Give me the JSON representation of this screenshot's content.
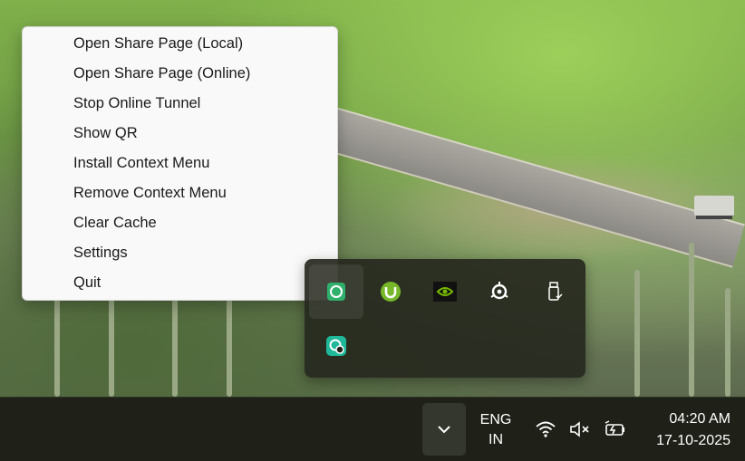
{
  "context_menu": {
    "items": [
      "Open Share Page (Local)",
      "Open Share Page (Online)",
      "Stop Online Tunnel",
      "Show QR",
      "Install Context Menu",
      "Remove Context Menu",
      "Clear Cache",
      "Settings",
      "Quit"
    ]
  },
  "tray_overflow": {
    "icons": [
      {
        "name": "share-app-icon",
        "color": "#2fb16b"
      },
      {
        "name": "utorrent-icon",
        "color": "#76b82a"
      },
      {
        "name": "nvidia-icon",
        "color": "#76b900"
      },
      {
        "name": "steelseries-icon",
        "color": "#ffffff"
      },
      {
        "name": "usb-drive-icon",
        "color": "#ffffff"
      },
      {
        "name": "sync-app-icon",
        "color": "#1fb89a"
      }
    ]
  },
  "taskbar": {
    "language_line1": "ENG",
    "language_line2": "IN",
    "time": "04:20 AM",
    "date": "17-10-2025",
    "system_icons": [
      "wifi-icon",
      "volume-muted-icon",
      "battery-charging-icon"
    ]
  }
}
